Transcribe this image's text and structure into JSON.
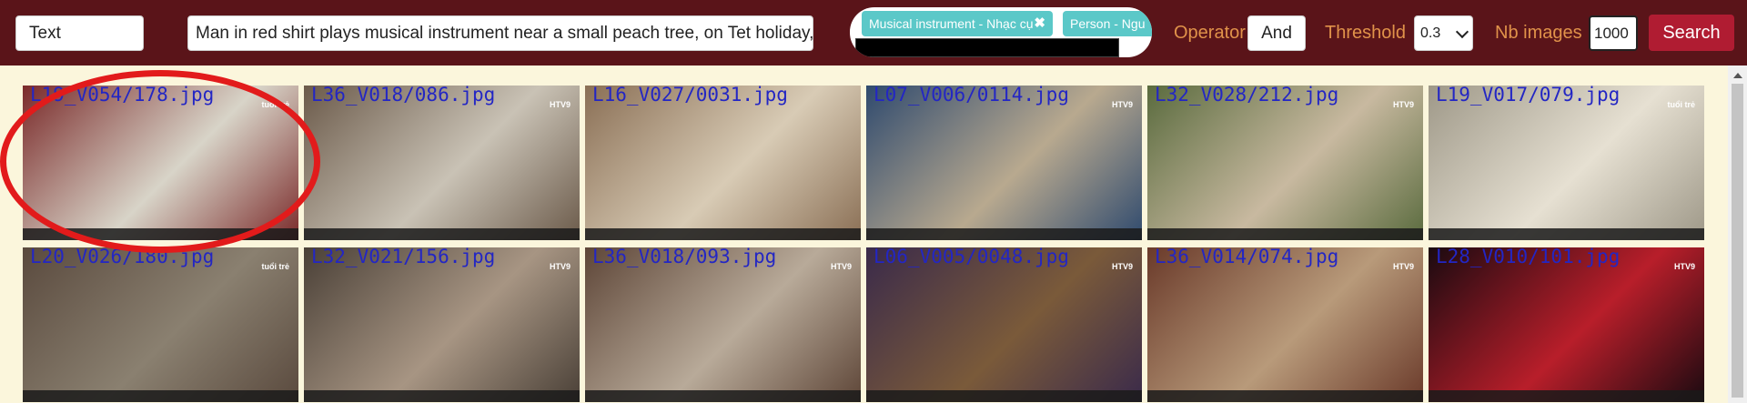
{
  "toolbar": {
    "type_value": "Text",
    "query_value": "Man in red shirt plays musical instrument near a small peach tree, on Tet holiday, in a",
    "tags": [
      {
        "label": "Musical instrument - Nhạc cụ"
      },
      {
        "label": "Person - Ngu"
      }
    ],
    "tag_close_glyph": "✖",
    "operator_label": "Operator",
    "operator_value": "And",
    "threshold_label": "Threshold",
    "threshold_value": "0.3",
    "nb_label": "Nb images",
    "nb_value": "1000",
    "search_label": "Search"
  },
  "results": [
    {
      "filename": "L19_V054/178.jpg",
      "logo": "tuổi trẻ",
      "colors": [
        "#7a2a2a",
        "#d8d4c8"
      ]
    },
    {
      "filename": "L36_V018/086.jpg",
      "logo": "HTV9",
      "colors": [
        "#6b5a4a",
        "#c9c2b5"
      ]
    },
    {
      "filename": "L16_V027/0031.jpg",
      "logo": "",
      "colors": [
        "#8a6f55",
        "#d8cbb5"
      ]
    },
    {
      "filename": "L07_V006/0114.jpg",
      "logo": "HTV9",
      "colors": [
        "#2f4a6e",
        "#b8a98f"
      ]
    },
    {
      "filename": "L32_V028/212.jpg",
      "logo": "HTV9",
      "colors": [
        "#5a6b3e",
        "#c8b9a0"
      ]
    },
    {
      "filename": "L19_V017/079.jpg",
      "logo": "tuổi trẻ",
      "colors": [
        "#9e9888",
        "#e6e0d2"
      ]
    },
    {
      "filename": "L20_V026/180.jpg",
      "logo": "tuổi trẻ",
      "colors": [
        "#5a4a3e",
        "#8a8070"
      ]
    },
    {
      "filename": "L32_V021/156.jpg",
      "logo": "HTV9",
      "colors": [
        "#4a4037",
        "#a79583"
      ]
    },
    {
      "filename": "L36_V018/093.jpg",
      "logo": "HTV9",
      "colors": [
        "#5e4638",
        "#b8aa99"
      ]
    },
    {
      "filename": "L06_V005/0048.jpg",
      "logo": "HTV9",
      "colors": [
        "#3a2a4a",
        "#7a5a3a"
      ]
    },
    {
      "filename": "L36_V014/074.jpg",
      "logo": "HTV9",
      "colors": [
        "#6a3a2a",
        "#b89a7a"
      ]
    },
    {
      "filename": "L28_V010/101.jpg",
      "logo": "HTV9",
      "colors": [
        "#1a0a10",
        "#b81e2a"
      ]
    }
  ],
  "colors": {
    "topbar": "#5a1419",
    "accent_label": "#e0924a",
    "tag": "#5bc8c8",
    "search_button": "#b01c32",
    "filename_text": "#2326c4",
    "annotation": "#e21b1b"
  }
}
